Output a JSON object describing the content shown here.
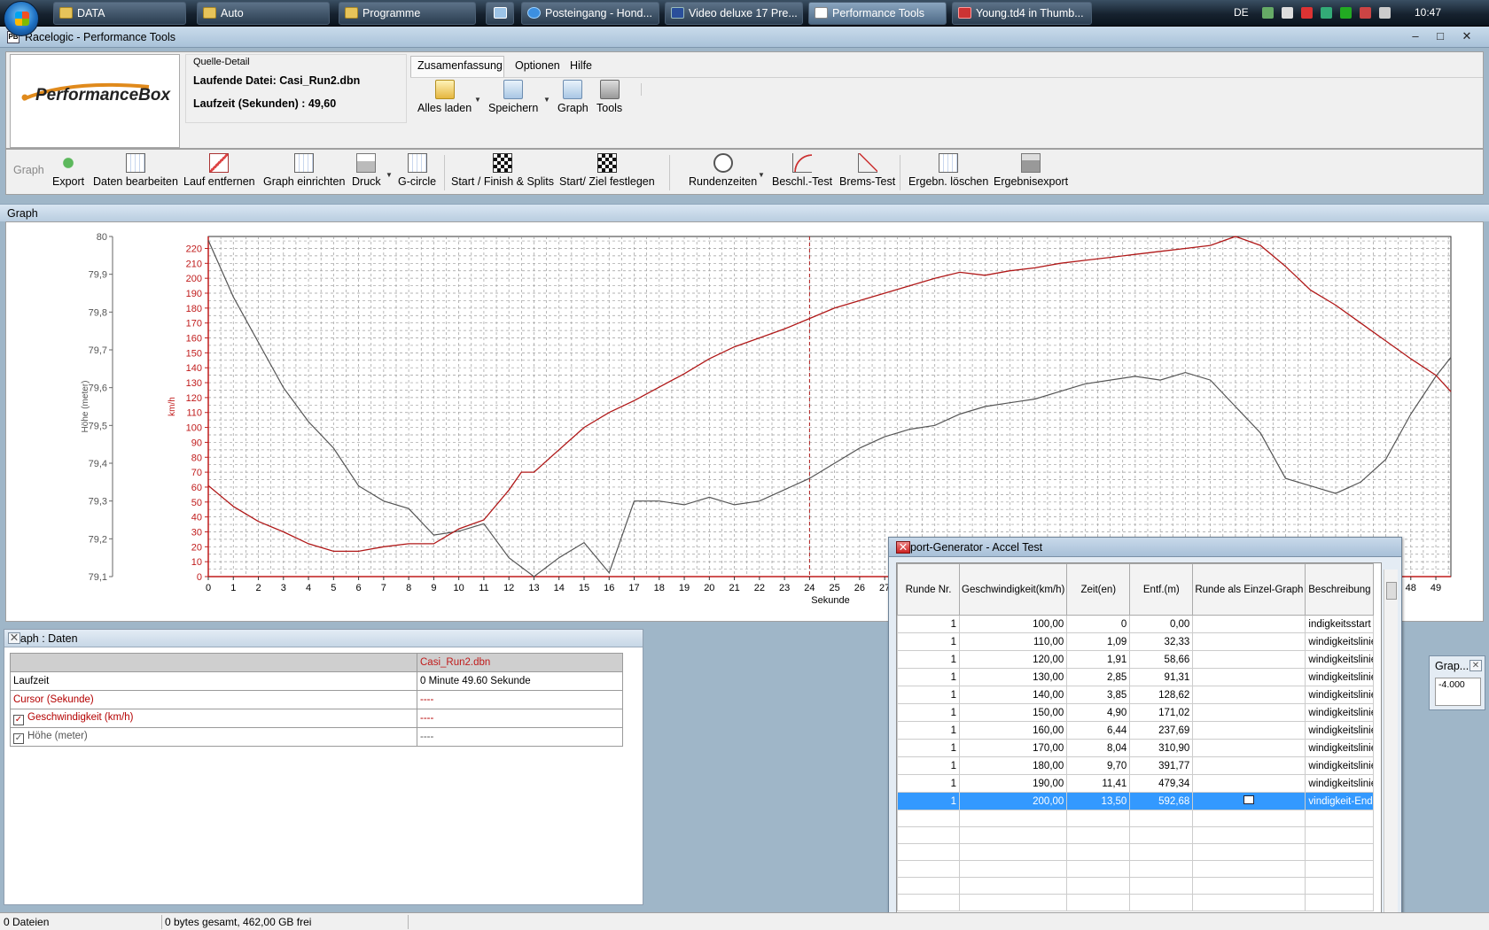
{
  "taskbar": {
    "buttons": [
      "DATA",
      "Auto",
      "Programme",
      "Posteingang - Hond...",
      "Video deluxe 17 Pre...",
      "Performance Tools",
      "Young.td4 in Thumb..."
    ],
    "language": "DE",
    "clock": "10:47"
  },
  "app": {
    "title": "Racelogic - Performance Tools",
    "logo_text": "PerformanceBox",
    "source": {
      "legend": "Quelle-Detail",
      "file_line": "Laufende Datei: Casi_Run2.dbn",
      "runtime_line": "Laufzeit (Sekunden) : 49,60"
    },
    "menu": [
      "Zusamenfassung",
      "Optionen",
      "Hilfe"
    ],
    "quick_actions": [
      "Alles laden",
      "Speichern",
      "Graph",
      "Tools"
    ],
    "toolbar": {
      "group_label": "Graph",
      "items": [
        "Export",
        "Daten bearbeiten",
        "Lauf entfernen",
        "Graph einrichten",
        "Druck",
        "G-circle",
        "Start / Finish & Splits",
        "Start/ Ziel festlegen",
        "Rundenzeiten",
        "Beschl.-Test",
        "Brems-Test",
        "Ergebn. löschen",
        "Ergebnisexport"
      ]
    }
  },
  "graph_panel": {
    "title": "Graph"
  },
  "data_panel": {
    "title": "Graph : Daten",
    "file_header": "Casi_Run2.dbn",
    "rows": [
      {
        "label": "Laufzeit",
        "value": "0 Minute 49.60 Sekunde"
      },
      {
        "label": "Cursor (Sekunde)",
        "value": "----"
      },
      {
        "label": "Geschwindigkeit (km/h)",
        "value": "----"
      },
      {
        "label": "Höhe (meter)",
        "value": "----"
      }
    ]
  },
  "report": {
    "title": "Report-Generator - Accel Test",
    "columns": [
      "Runde Nr.",
      "Geschwindigkeit(km/h)",
      "Zeit(en)",
      "Entf.(m)",
      "Runde als Einzel-Graph",
      "Beschreibung"
    ],
    "rows": [
      [
        "1",
        "100,00",
        "0",
        "0,00",
        "",
        "indigkeitsstart"
      ],
      [
        "1",
        "110,00",
        "1,09",
        "32,33",
        "",
        "windigkeitslinie"
      ],
      [
        "1",
        "120,00",
        "1,91",
        "58,66",
        "",
        "windigkeitslinie"
      ],
      [
        "1",
        "130,00",
        "2,85",
        "91,31",
        "",
        "windigkeitslinie"
      ],
      [
        "1",
        "140,00",
        "3,85",
        "128,62",
        "",
        "windigkeitslinie"
      ],
      [
        "1",
        "150,00",
        "4,90",
        "171,02",
        "",
        "windigkeitslinie"
      ],
      [
        "1",
        "160,00",
        "6,44",
        "237,69",
        "",
        "windigkeitslinie"
      ],
      [
        "1",
        "170,00",
        "8,04",
        "310,90",
        "",
        "windigkeitslinie"
      ],
      [
        "1",
        "180,00",
        "9,70",
        "391,77",
        "",
        "windigkeitslinie"
      ],
      [
        "1",
        "190,00",
        "11,41",
        "479,34",
        "",
        "windigkeitslinie"
      ],
      [
        "1",
        "200,00",
        "13,50",
        "592,68",
        "",
        "vindigkeit-Ende"
      ]
    ],
    "selected_row": 10
  },
  "mini_window": {
    "title": "Grap...",
    "value": "-4.000"
  },
  "statusbar": {
    "files": "0 Dateien",
    "space": "0 bytes gesamt, 462,00 GB frei"
  },
  "chart_data": {
    "type": "line",
    "xlabel": "Sekunde",
    "y_left_label": "Höhe (meter)",
    "y_right_label": "km/h",
    "x_ticks": [
      0,
      1,
      2,
      3,
      4,
      5,
      6,
      7,
      8,
      9,
      10,
      11,
      12,
      13,
      14,
      15,
      16,
      17,
      18,
      19,
      20,
      21,
      22,
      23,
      24,
      25,
      26,
      27,
      48,
      49
    ],
    "x_range": [
      0,
      49.6
    ],
    "y_speed_ticks": [
      0,
      10,
      20,
      30,
      40,
      50,
      60,
      70,
      80,
      90,
      100,
      110,
      120,
      130,
      140,
      150,
      160,
      170,
      180,
      190,
      200,
      210,
      220
    ],
    "y_speed_range": [
      0,
      228
    ],
    "y_height_ticks": [
      "79,1",
      "79,2",
      "79,3",
      "79,4",
      "79,5",
      "79,6",
      "79,7",
      "79,8",
      "79,9",
      "80"
    ],
    "y_height_range": [
      79.1,
      80.0
    ],
    "cursor_x": 24,
    "series": [
      {
        "name": "Geschwindigkeit (km/h)",
        "color": "#b01818",
        "x": [
          0,
          1,
          2,
          3,
          4,
          5,
          6,
          7,
          8,
          9,
          10,
          11,
          12,
          12.5,
          13,
          14,
          15,
          16,
          17,
          18,
          19,
          20,
          21,
          22,
          23,
          24,
          25,
          26,
          27,
          28,
          29,
          30,
          31,
          32,
          33,
          34,
          35,
          36,
          37,
          38,
          39,
          40,
          41,
          42,
          43,
          44,
          45,
          46,
          47,
          48,
          49,
          49.6
        ],
        "y": [
          61,
          47,
          37,
          30,
          22,
          17,
          17,
          20,
          22,
          22,
          32,
          38,
          58,
          70,
          70,
          85,
          100,
          110,
          118,
          127,
          136,
          146,
          154,
          160,
          166,
          173,
          180,
          185,
          190,
          195,
          200,
          204,
          202,
          205,
          207,
          210,
          212,
          214,
          216,
          218,
          220,
          222,
          228,
          222,
          208,
          192,
          182,
          170,
          158,
          146,
          135,
          124
        ]
      },
      {
        "name": "Höhe (meter)",
        "color": "#555555",
        "x": [
          0,
          1,
          2,
          3,
          4,
          5,
          6,
          7,
          8,
          9,
          10,
          11,
          12,
          13,
          14,
          15,
          16,
          17,
          18,
          19,
          20,
          21,
          22,
          23,
          24,
          25,
          26,
          27,
          28,
          29,
          30,
          31,
          32,
          33,
          34,
          35,
          36,
          37,
          38,
          39,
          40,
          41,
          42,
          43,
          44,
          45,
          46,
          47,
          48,
          49,
          49.6
        ],
        "y": [
          79.99,
          79.84,
          79.72,
          79.6,
          79.51,
          79.44,
          79.34,
          79.3,
          79.28,
          79.21,
          79.22,
          79.24,
          79.15,
          79.1,
          79.15,
          79.19,
          79.11,
          79.3,
          79.3,
          79.29,
          79.31,
          79.29,
          79.3,
          79.33,
          79.36,
          79.4,
          79.44,
          79.47,
          79.49,
          79.5,
          79.53,
          79.55,
          79.56,
          79.57,
          79.59,
          79.61,
          79.62,
          79.63,
          79.62,
          79.64,
          79.62,
          79.55,
          79.48,
          79.36,
          79.34,
          79.32,
          79.35,
          79.41,
          79.53,
          79.63,
          79.68
        ]
      }
    ]
  }
}
